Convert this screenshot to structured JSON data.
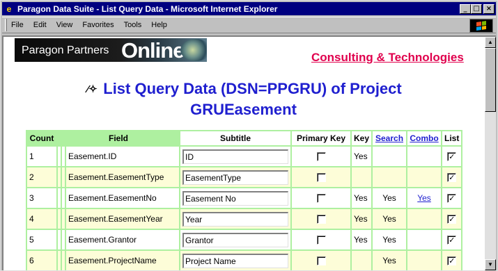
{
  "window": {
    "title": "Paragon Data Suite - List Query Data - Microsoft Internet Explorer",
    "buttons": {
      "minimize": "_",
      "maximize": "□",
      "close": "×"
    }
  },
  "menu": [
    "File",
    "Edit",
    "View",
    "Favorites",
    "Tools",
    "Help"
  ],
  "banner": {
    "left_text": "Paragon Partners",
    "right_text": "Online"
  },
  "consulting_link": "Consulting & Technologies",
  "heading": {
    "line1": "List Query Data (DSN=PPGRU) of Project",
    "line2": "GRUEasement"
  },
  "table": {
    "headers": {
      "count": "Count",
      "field": "Field",
      "subtitle": "Subtitle",
      "primary_key": "Primary Key",
      "key": "Key",
      "search": "Search",
      "combo": "Combo",
      "list": "List"
    },
    "rows": [
      {
        "count": "1",
        "field": "Easement.ID",
        "subtitle": "ID",
        "primary_key": false,
        "key": "Yes",
        "search": "",
        "combo": "",
        "list": true
      },
      {
        "count": "2",
        "field": "Easement.EasementType",
        "subtitle": "EasementType",
        "primary_key": false,
        "key": "",
        "search": "",
        "combo": "",
        "list": true
      },
      {
        "count": "3",
        "field": "Easement.EasementNo",
        "subtitle": "Easement No",
        "primary_key": false,
        "key": "Yes",
        "search": "Yes",
        "combo": "Yes",
        "list": true
      },
      {
        "count": "4",
        "field": "Easement.EasementYear",
        "subtitle": "Year",
        "primary_key": false,
        "key": "Yes",
        "search": "Yes",
        "combo": "",
        "list": true
      },
      {
        "count": "5",
        "field": "Easement.Grantor",
        "subtitle": "Grantor",
        "primary_key": false,
        "key": "Yes",
        "search": "Yes",
        "combo": "",
        "list": true
      },
      {
        "count": "6",
        "field": "Easement.ProjectName",
        "subtitle": "Project Name",
        "primary_key": false,
        "key": "",
        "search": "Yes",
        "combo": "",
        "list": true
      }
    ]
  },
  "colors": {
    "title_bar": "#000080",
    "heading": "#1f1fcf",
    "consulting": "#e0004d",
    "table_border": "#aef0a0",
    "alt_row": "#fdfdd8"
  }
}
